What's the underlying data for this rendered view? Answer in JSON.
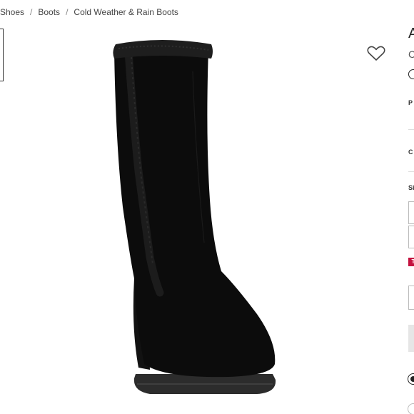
{
  "breadcrumb": {
    "items": [
      "Shoes",
      "Boots",
      "Cold Weather & Rain Boots"
    ],
    "separator": "/"
  },
  "product": {
    "image_alt": "Black suede knee-high wedge boot with faux fur trim",
    "boot_color": "#0c0c0c",
    "fur_color": "#1a1a1a"
  },
  "wishlist": {
    "icon": "heart-outline-icon"
  },
  "details": {
    "title_initial": "A",
    "subtitle_initial": "C",
    "price_label_initial": "P",
    "color_label_initial": "C",
    "size_label_initial": "Si",
    "badge_initial": "T"
  },
  "colors": {
    "accent": "#c4123f"
  }
}
